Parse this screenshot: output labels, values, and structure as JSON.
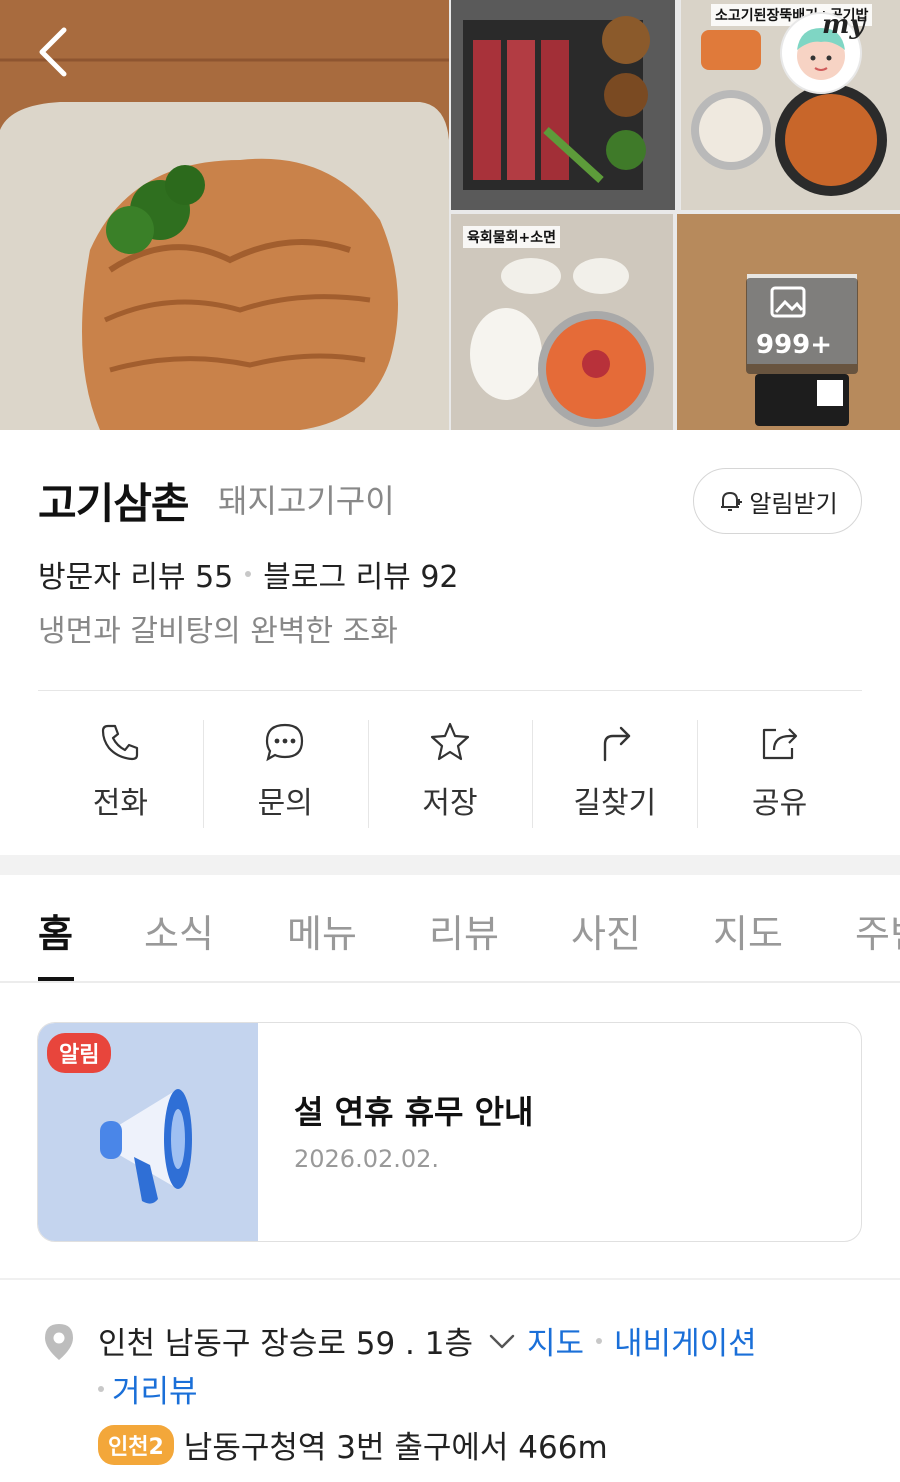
{
  "gallery": {
    "labels": {
      "top_right": "소고기된장뚝배기+공기밥",
      "middle": "육회물회+소면"
    },
    "more_count": "999+",
    "avatar_text": "my"
  },
  "place": {
    "name": "고기삼촌",
    "category": "돼지고기구이",
    "visitor_reviews": "방문자 리뷰 55",
    "blog_reviews": "블로그 리뷰 92",
    "tagline": "냉면과 갈비탕의 완벽한 조화"
  },
  "notify_button": "알림받기",
  "actions": [
    {
      "label": "전화",
      "icon": "phone-icon"
    },
    {
      "label": "문의",
      "icon": "chat-icon"
    },
    {
      "label": "저장",
      "icon": "star-icon"
    },
    {
      "label": "길찾기",
      "icon": "directions-icon"
    },
    {
      "label": "공유",
      "icon": "share-icon"
    }
  ],
  "tabs": [
    "홈",
    "소식",
    "메뉴",
    "리뷰",
    "사진",
    "지도",
    "주변"
  ],
  "notice": {
    "badge": "알림",
    "title": "설 연휴 휴무 안내",
    "date": "2026.02.02."
  },
  "address": {
    "text": "인천 남동구 장승로 59 . 1층",
    "map_link": "지도",
    "nav_link": "내비게이션",
    "street_link": "거리뷰"
  },
  "subway": {
    "line": "인천2",
    "text": "남동구청역 3번 출구에서 466m",
    "line_color": "#f3a73a"
  },
  "colors": {
    "link": "#1a6fd8",
    "badge_red": "#e8453c"
  }
}
